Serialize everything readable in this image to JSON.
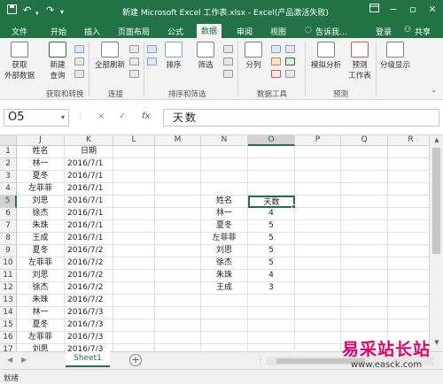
{
  "titlebar": {
    "title": "新建 Microsoft Excel 工作表.xlsx - Excel(产品激活失败)",
    "icons": [
      "save-icon",
      "undo-icon",
      "redo-icon",
      "customize-icon"
    ],
    "window_icons": [
      "ribbon-options-icon",
      "minimize-icon",
      "restore-icon",
      "close-icon"
    ]
  },
  "menubar": {
    "tabs": [
      "文件",
      "开始",
      "插入",
      "页面布局",
      "公式",
      "数据",
      "审阅",
      "视图"
    ],
    "active_tab": "数据",
    "tell_me": "告诉我...",
    "login": "登录",
    "share": "共享"
  },
  "ribbon": {
    "buttons": {
      "get_external": "获取\n外部数据",
      "new_query": "新建\n查询",
      "refresh_all": "全部刷新",
      "sort": "排序",
      "filter": "筛选",
      "split": "分列",
      "whatif": "模拟分析",
      "forecast": "预测\n工作表",
      "outline": "分级显示"
    },
    "groups": [
      "获取和转换",
      "连接",
      "排序和筛选",
      "数据工具",
      "预测"
    ]
  },
  "formula_bar": {
    "name_box": "O5",
    "cancel": "×",
    "enter": "✓",
    "fx": "fx",
    "value": "天数"
  },
  "grid": {
    "columns": [
      "J",
      "K",
      "L",
      "M",
      "N",
      "O",
      "P",
      "Q",
      "R"
    ],
    "rows": [
      "1",
      "2",
      "3",
      "4",
      "5",
      "6",
      "7",
      "8",
      "9",
      "10",
      "11",
      "12",
      "13",
      "14",
      "15",
      "16",
      "17"
    ],
    "selected_column": "O",
    "selected_row": "5",
    "col_j": [
      "姓名",
      "林一",
      "夏冬",
      "左菲菲",
      "刘思",
      "徐杰",
      "朱珠",
      "王成",
      "夏冬",
      "左菲菲",
      "刘思",
      "徐杰",
      "朱珠",
      "林一",
      "夏冬",
      "左菲菲",
      "刘思"
    ],
    "col_k": [
      "日期",
      "2016/7/1",
      "2016/7/1",
      "2016/7/1",
      "2016/7/1",
      "2016/7/1",
      "2016/7/1",
      "2016/7/1",
      "2016/7/2",
      "2016/7/2",
      "2016/7/2",
      "2016/7/2",
      "2016/7/2",
      "2016/7/3",
      "2016/7/3",
      "2016/7/3",
      "2016/7/3"
    ],
    "col_n": [
      "姓名",
      "林一",
      "夏冬",
      "左菲菲",
      "刘思",
      "徐杰",
      "朱珠",
      "王成"
    ],
    "col_o": [
      "天数",
      "4",
      "5",
      "5",
      "5",
      "5",
      "4",
      "3"
    ]
  },
  "sheets": {
    "active": "Sheet1",
    "add": "+"
  },
  "status": {
    "ready": "就绪"
  },
  "watermark": {
    "brand": "易采站长站",
    "url": "www.easck.com"
  },
  "colors": {
    "excel_green": "#217346",
    "watermark_pink": "#e0006b"
  }
}
